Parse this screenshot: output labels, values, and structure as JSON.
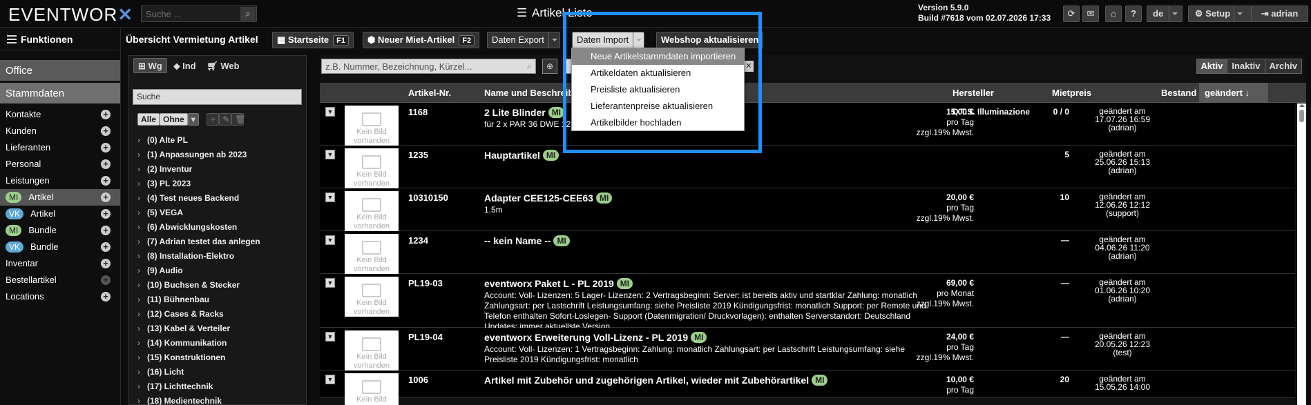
{
  "topbar": {
    "logo_text": "EVENTWOR",
    "logo_x": "✕",
    "search_placeholder": "Suche ...",
    "title": "Artikel Liste",
    "version_line1": "Version 5.9.0",
    "version_line2": "Build #7618 vom 02.07.2026 17:33",
    "lang": "de",
    "setup": "Setup",
    "user": "adrian",
    "help": "?"
  },
  "sidebar": {
    "title": "Funktionen",
    "section_office": "Office",
    "section_stamm": "Stammdaten",
    "items": [
      {
        "label": "Kontakte"
      },
      {
        "label": "Kunden"
      },
      {
        "label": "Lieferanten"
      },
      {
        "label": "Personal"
      },
      {
        "label": "Leistungen"
      },
      {
        "badge": "MI",
        "label": "Artikel"
      },
      {
        "badge": "VK",
        "label": "Artikel"
      },
      {
        "badge": "MI",
        "label": "Bundle"
      },
      {
        "badge": "VK",
        "label": "Bundle"
      },
      {
        "label": "Inventar"
      },
      {
        "label": "Bestellartikel"
      },
      {
        "label": "Locations"
      }
    ]
  },
  "header2": {
    "title": "Übersicht Vermietung Artikel",
    "startseite": "Startseite",
    "startseite_key": "F1",
    "neuer": "Neuer Miet-Artikel",
    "neuer_key": "F2",
    "export": "Daten Export",
    "import": "Daten Import",
    "webshop": "Webshop aktualisieren"
  },
  "tree": {
    "tab_wg": "Wg",
    "tab_ind": "Ind",
    "tab_web": "Web",
    "search": "Suche",
    "btn_alle": "Alle",
    "btn_ohne": "Ohne",
    "items": [
      "(0) Alte PL",
      "(1) Anpassungen ab 2023",
      "(2) Inventur",
      "(3) PL 2023",
      "(4) Test neues Backend",
      "(5) VEGA",
      "(6) Abwicklungskosten",
      "(7) Adrian testet das anlegen",
      "(8) Installation-Elektro",
      "(9) Audio",
      "(10) Buchsen & Stecker",
      "(11) Bühnenbau",
      "(12) Cases & Racks",
      "(13) Kabel & Verteiler",
      "(14) Kommunikation",
      "(15) Konstruktionen",
      "(16) Licht",
      "(17) Lichttechnik",
      "(18) Medientechnik"
    ]
  },
  "main": {
    "search_placeholder": "z.B. Nummer, Bezeichnung, Kürzel...",
    "filter_active": "Aktiv",
    "filter_inactive": "Inaktiv",
    "filter_archive": "Archiv",
    "columns": {
      "nr": "Artikel-Nr.",
      "name": "Name und Beschreib",
      "herst": "Hersteller",
      "price": "Mietpreis",
      "best": "Bestand",
      "chg": "geändert ↓"
    },
    "no_image": "Kein Bild vorhanden",
    "badge": "MI",
    "rows": [
      {
        "nr": "1168",
        "name": "2 Lite Blinder",
        "desc": "für 2 x PAR 36 DWE 12",
        "desc2": "z",
        "herst": "D.T.S. Illuminazione",
        "price1": "15,00 €",
        "price2": "pro Tag",
        "price3": "zzgl.19% Mwst.",
        "best": "0 / 0",
        "chg1": "geändert am",
        "chg2": "17.07.26 16:59",
        "chg3": "(adrian)"
      },
      {
        "nr": "1235",
        "name": "Hauptartikel",
        "desc": "",
        "herst": "",
        "price1": "",
        "price2": "",
        "price3": "",
        "best": "5",
        "chg1": "geändert am",
        "chg2": "25.06.26 15:13",
        "chg3": "(adrian)"
      },
      {
        "nr": "10310150",
        "name": "Adapter CEE125-CEE63",
        "desc": "1.5m",
        "herst": "",
        "price1": "20,00 €",
        "price2": "pro Tag",
        "price3": "zzgl.19% Mwst.",
        "best": "10",
        "chg1": "geändert am",
        "chg2": "12.06.26 12:12",
        "chg3": "(support)"
      },
      {
        "nr": "1234",
        "name": "-- kein Name --",
        "desc": "",
        "herst": "",
        "price1": "",
        "price2": "",
        "price3": "",
        "best": "—",
        "chg1": "geändert am",
        "chg2": "04.06.26 11:20",
        "chg3": "(adrian)"
      },
      {
        "nr": "PL19-03",
        "name": "eventworx Paket L - PL 2019",
        "desc": "Account: Voll- Lizenzen: 5 Lager- Lizenzen: 2 Vertragsbeginn: Server: ist bereits aktiv und startklar Zahlung: monatlich Zahlungsart: per Lastschrift Leistungsumfang: siehe Preisliste 2019 Kündigungsfrist: monatlich Support: per Remote und Telefon enthalten Sofort-Loslegen- Support (Datenmigration/ Druckvorlagen): enthalten Serverstandort: Deutschland Updates: immer aktuellste Version",
        "herst": "",
        "price1": "69,00 €",
        "price2": "pro Monat",
        "price3": "zzgl.19% Mwst.",
        "best": "—",
        "chg1": "geändert am",
        "chg2": "01.06.26 10:20",
        "chg3": "(adrian)"
      },
      {
        "nr": "PL19-04",
        "name": "eventworx Erweiterung Voll-Lizenz - PL 2019",
        "desc": "Account: Voll- Lizenzen: 1 Vertragsbeginn: Zahlung: monatlich Zahlungsart: per Lastschrift Leistungsumfang: siehe Preisliste 2019 Kündigungsfrist: monatlich",
        "herst": "",
        "price1": "24,00 €",
        "price2": "pro Tag",
        "price3": "zzgl.19% Mwst.",
        "best": "—",
        "chg1": "geändert am",
        "chg2": "20.05.26 12:23",
        "chg3": "(test)"
      },
      {
        "nr": "1006",
        "name": "Artikel mit Zubehör und zugehörigen Artikel, wieder mit Zubehörartikel",
        "desc": "",
        "herst": "",
        "price1": "10,00 €",
        "price2": "pro Tag",
        "price3": "",
        "best": "20",
        "chg1": "geändert am",
        "chg2": "15.05.26 14:00",
        "chg3": ""
      }
    ]
  },
  "import_menu": [
    "Neue Artikelstammdaten importieren",
    "Artikeldaten aktualisieren",
    "Preisliste aktualisieren",
    "Lieferantenpreise aktualisieren",
    "Artikelbilder hochladen"
  ]
}
